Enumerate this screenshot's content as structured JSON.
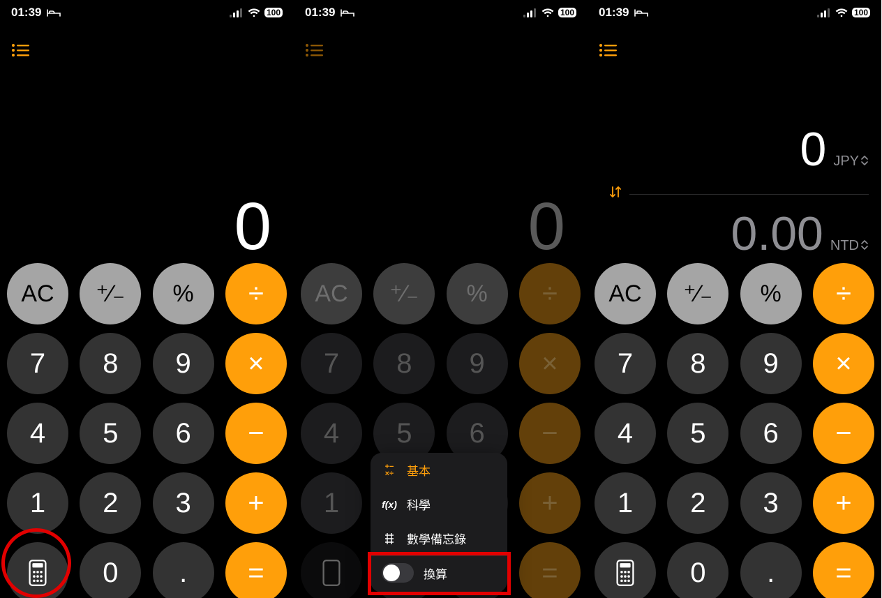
{
  "common": {
    "time": "01:39",
    "battery": "100",
    "display_zero": "0",
    "ac": "AC",
    "plusminus": "⁺∕₋",
    "percent": "%",
    "divide": "÷",
    "multiply": "×",
    "minus": "−",
    "plus": "+",
    "equals": "=",
    "dot": ".",
    "d0": "0",
    "d1": "1",
    "d2": "2",
    "d3": "3",
    "d4": "4",
    "d5": "5",
    "d6": "6",
    "d7": "7",
    "d8": "8",
    "d9": "9"
  },
  "screen2": {
    "menu": {
      "basic_icon": "⁺⁻×÷",
      "basic": "基本",
      "scientific_icon": "f(x)",
      "scientific": "科學",
      "mathnotes_icon": "⌗",
      "mathnotes": "數學備忘錄",
      "convert": "換算"
    }
  },
  "screen3": {
    "top_value": "0",
    "top_code": "JPY",
    "bottom_value": "0.00",
    "bottom_code": "NTD"
  }
}
